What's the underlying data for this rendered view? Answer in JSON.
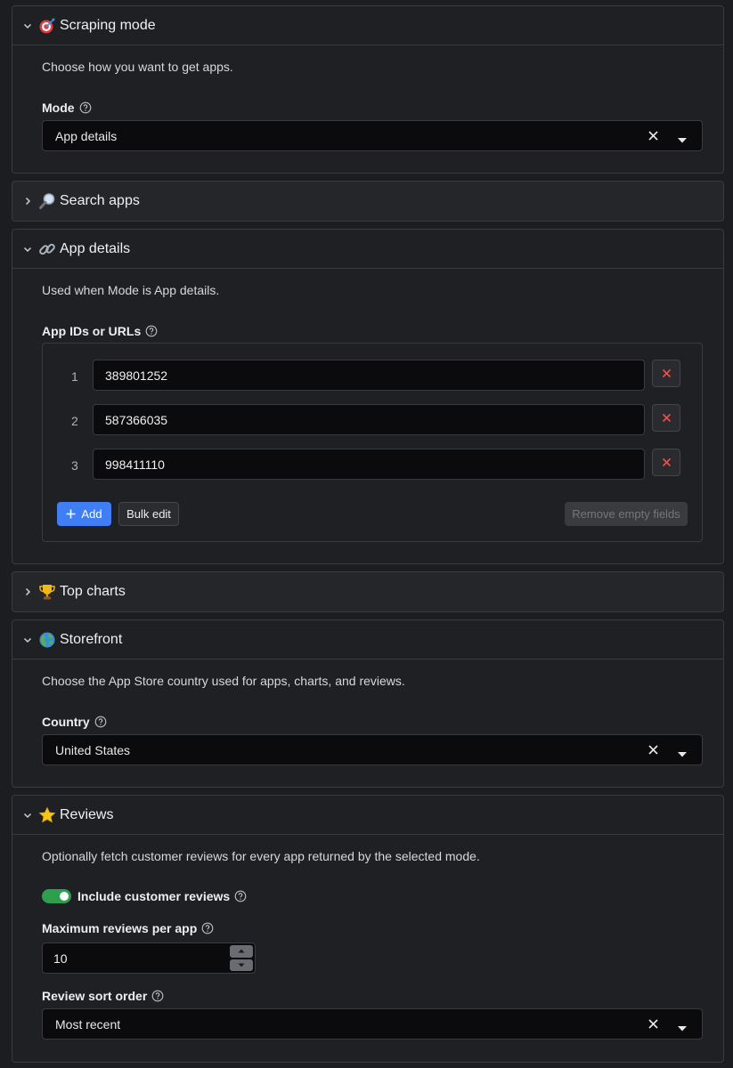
{
  "sections": {
    "scraping_mode": {
      "title": "Scraping mode",
      "icon": "target-icon",
      "description": "Choose how you want to get apps.",
      "mode_label": "Mode",
      "mode_value": "App details"
    },
    "search_apps": {
      "title": "Search apps",
      "icon": "magnifier-icon"
    },
    "app_details": {
      "title": "App details",
      "icon": "link-icon",
      "description": "Used when Mode is App details.",
      "ids_label": "App IDs or URLs",
      "rows": [
        {
          "num": "1",
          "value": "389801252"
        },
        {
          "num": "2",
          "value": "587366035"
        },
        {
          "num": "3",
          "value": "998411110"
        }
      ],
      "add_label": "Add",
      "bulk_label": "Bulk edit",
      "remove_label": "Remove empty fields"
    },
    "top_charts": {
      "title": "Top charts",
      "icon": "trophy-icon"
    },
    "storefront": {
      "title": "Storefront",
      "icon": "globe-icon",
      "description": "Choose the App Store country used for apps, charts, and reviews.",
      "country_label": "Country",
      "country_value": "United States"
    },
    "reviews": {
      "title": "Reviews",
      "icon": "star-icon",
      "description": "Optionally fetch customer reviews for every app returned by the selected mode.",
      "include_label": "Include customer reviews",
      "include_on": true,
      "max_label": "Maximum reviews per app",
      "max_value": "10",
      "sort_label": "Review sort order",
      "sort_value": "Most recent"
    }
  },
  "colors": {
    "accent": "#3f7ef5",
    "toggle_on": "#2e9e4f",
    "delete": "#e5534b"
  }
}
